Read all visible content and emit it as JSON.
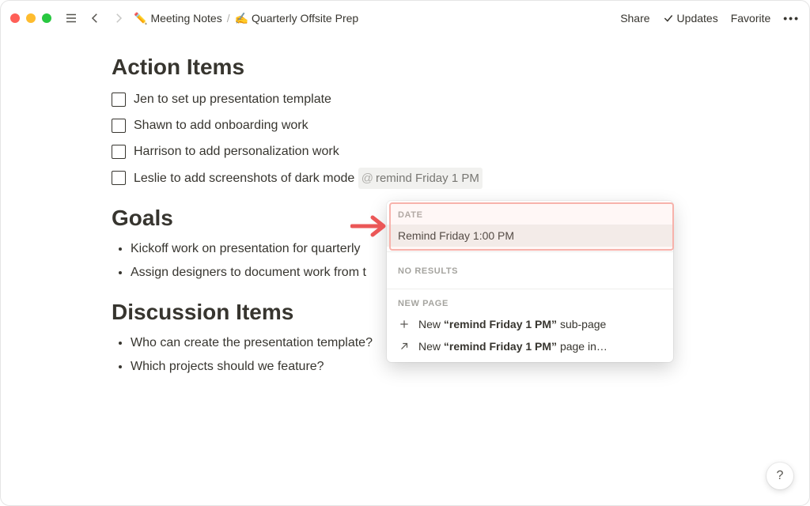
{
  "topbar": {
    "breadcrumbs": [
      {
        "emoji": "✏️",
        "label": "Meeting Notes"
      },
      {
        "emoji": "✍️",
        "label": "Quarterly Offsite Prep"
      }
    ],
    "share": "Share",
    "updates": "Updates",
    "favorite": "Favorite"
  },
  "doc": {
    "action_items_heading": "Action Items",
    "action_items": [
      {
        "text": "Jen to set up presentation template",
        "mention": null
      },
      {
        "text": "Shawn to add onboarding work",
        "mention": null
      },
      {
        "text": "Harrison to add personalization work",
        "mention": null
      },
      {
        "text": "Leslie to add screenshots of dark mode ",
        "mention": "remind Friday 1 PM"
      }
    ],
    "goals_heading": "Goals",
    "goals": [
      "Kickoff work on presentation for quarterly",
      "Assign designers to document work from t"
    ],
    "discussion_heading": "Discussion Items",
    "discussion": [
      "Who can create the presentation template?",
      "Which projects should we feature?"
    ]
  },
  "popover": {
    "date_label": "DATE",
    "date_option": "Remind Friday 1:00 PM",
    "no_results": "NO RESULTS",
    "new_page_label": "NEW PAGE",
    "new_subpage_prefix": "New ",
    "new_subpage_quoted": "“remind Friday 1 PM”",
    "new_subpage_suffix": " sub-page",
    "new_pagein_prefix": "New ",
    "new_pagein_quoted": "“remind Friday 1 PM”",
    "new_pagein_suffix": " page in…"
  },
  "help": "?"
}
